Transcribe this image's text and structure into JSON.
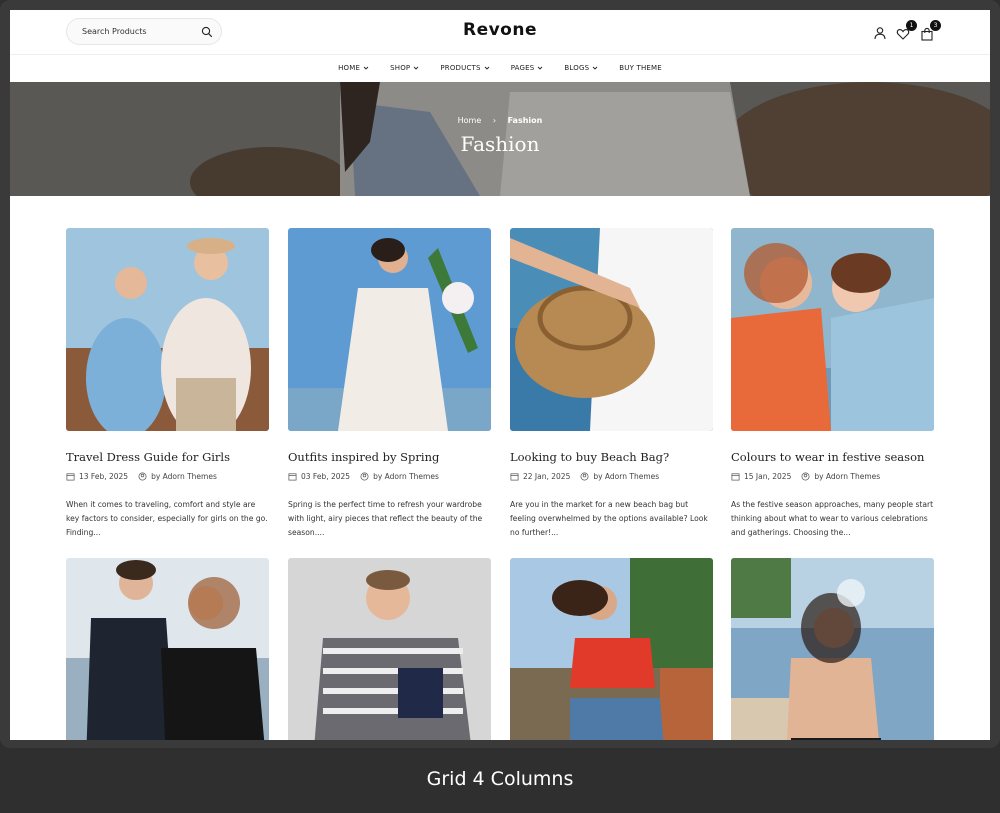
{
  "header": {
    "search_placeholder": "Search Products",
    "logo": "Revone",
    "wishlist_count": "1",
    "cart_count": "3"
  },
  "nav": {
    "items": [
      {
        "label": "HOME",
        "dropdown": true
      },
      {
        "label": "SHOP",
        "dropdown": true
      },
      {
        "label": "PRODUCTS",
        "dropdown": true
      },
      {
        "label": "PAGES",
        "dropdown": true
      },
      {
        "label": "BLOGS",
        "dropdown": true
      },
      {
        "label": "BUY THEME",
        "dropdown": false
      }
    ]
  },
  "hero": {
    "breadcrumb_home": "Home",
    "breadcrumb_current": "Fashion",
    "title": "Fashion"
  },
  "posts": [
    {
      "title": "Travel Dress Guide for Girls",
      "date": "13 Feb, 2025",
      "author": "by  Adorn Themes",
      "excerpt": "When it comes to traveling, comfort and style are key factors to consider, especially for girls on the go. Finding..."
    },
    {
      "title": "Outfits inspired by Spring",
      "date": "03 Feb, 2025",
      "author": "by  Adorn Themes",
      "excerpt": "Spring is the perfect time to refresh your wardrobe with light, airy pieces that reflect the beauty of the season...."
    },
    {
      "title": "Looking to buy Beach Bag?",
      "date": "22 Jan, 2025",
      "author": "by  Adorn Themes",
      "excerpt": "Are you in the market for a new beach bag but feeling overwhelmed by the options available? Look no further!..."
    },
    {
      "title": "Colours to wear in festive season",
      "date": "15 Jan, 2025",
      "author": "by  Adorn Themes",
      "excerpt": "As the festive season approaches, many people start thinking about what to wear to various celebrations and gatherings. Choosing the..."
    }
  ],
  "caption": "Grid 4 Columns",
  "icons": {
    "search": "search-icon",
    "user": "user-icon",
    "wishlist": "heart-icon",
    "cart": "bag-icon",
    "date": "calendar-icon",
    "author": "user-icon"
  }
}
